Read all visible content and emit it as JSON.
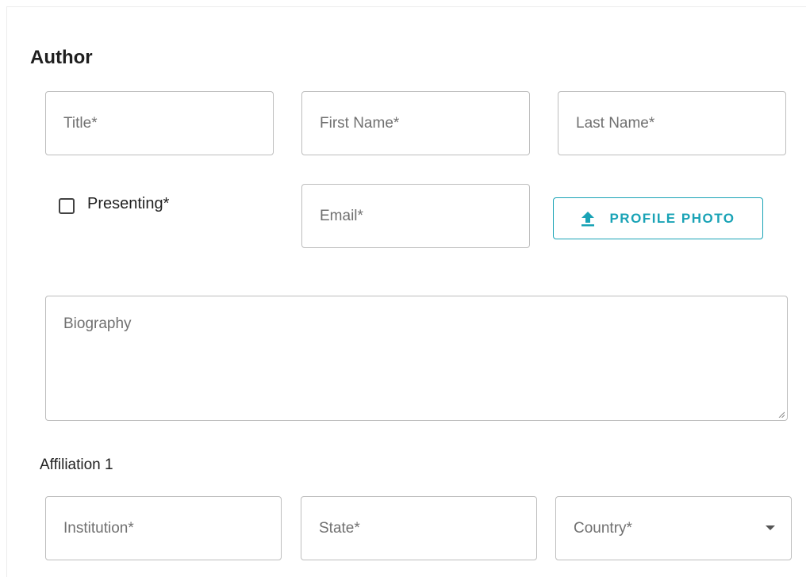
{
  "section": {
    "title": "Author"
  },
  "fields": {
    "title_placeholder": "Title*",
    "first_name_placeholder": "First Name*",
    "last_name_placeholder": "Last Name*",
    "email_placeholder": "Email*",
    "biography_placeholder": "Biography"
  },
  "presenting": {
    "label": "Presenting*",
    "checked": false
  },
  "upload": {
    "label": "PROFILE PHOTO",
    "icon": "upload-icon"
  },
  "affiliation": {
    "title": "Affiliation 1",
    "institution_placeholder": "Institution*",
    "state_placeholder": "State*",
    "country_placeholder": "Country*"
  },
  "colors": {
    "accent": "#1aa3b6",
    "border": "#bdbdbd"
  }
}
